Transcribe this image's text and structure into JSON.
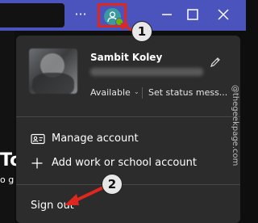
{
  "titlebar": {
    "more_label": "···",
    "icons": [
      "more-icon",
      "person-icon",
      "minimize-icon",
      "maximize-icon",
      "close-icon"
    ]
  },
  "left_panel": {
    "big_text": "To",
    "small_text": "o g"
  },
  "profile": {
    "name": "Sambit Koley",
    "status": "Available",
    "status_message": "Set status mess..."
  },
  "menu": {
    "manage_account": "Manage account",
    "add_account": "Add work or school account",
    "sign_out": "Sign out"
  },
  "annotations": {
    "step1": "1",
    "step2": "2"
  },
  "watermark": "@thegeekpage.com",
  "colors": {
    "titlebar": "#4b53bc",
    "highlight": "#e0271f",
    "presence": "#6bb700",
    "popup": "#2c2c2c"
  }
}
